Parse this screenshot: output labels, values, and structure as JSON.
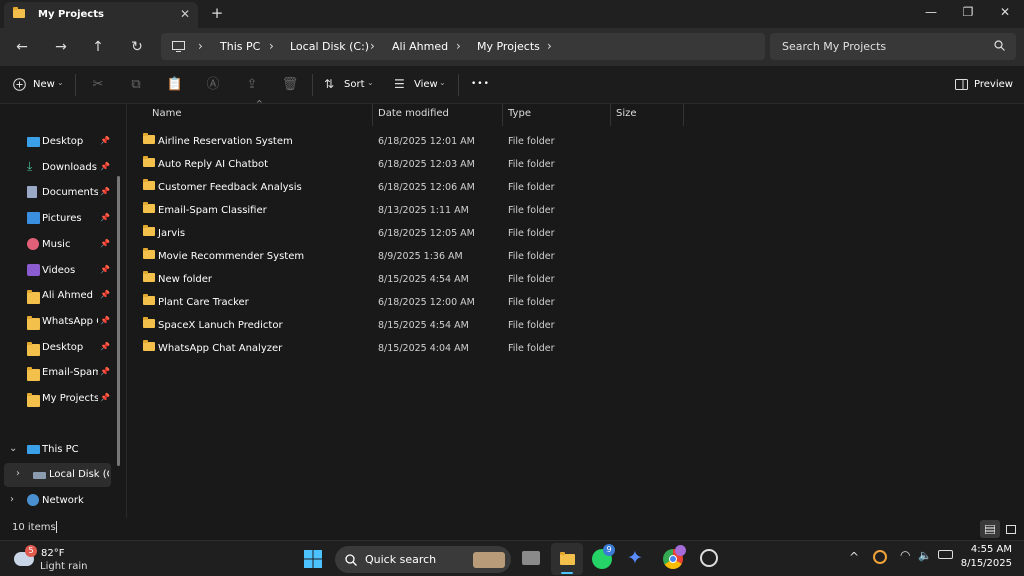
{
  "window": {
    "tab_title": "My Projects",
    "tab_close": "✕",
    "new_tab": "+",
    "minimize": "—",
    "restore": "❐",
    "close": "✕"
  },
  "nav": {
    "back": "←",
    "forward": "→",
    "up": "↑",
    "refresh": "↻",
    "breadcrumb": [
      "This PC",
      "Local Disk (C:)",
      "Ali Ahmed",
      "My Projects"
    ],
    "search_placeholder": "Search My Projects"
  },
  "toolbar": {
    "new_label": "New",
    "sort_label": "Sort",
    "view_label": "View",
    "more_label": "•••",
    "preview_label": "Preview"
  },
  "sidebar": {
    "quick_access": [
      {
        "label": "Desktop",
        "icon": "desktop-icon"
      },
      {
        "label": "Downloads",
        "icon": "download-icon"
      },
      {
        "label": "Documents",
        "icon": "documents-icon"
      },
      {
        "label": "Pictures",
        "icon": "pictures-icon"
      },
      {
        "label": "Music",
        "icon": "music-icon"
      },
      {
        "label": "Videos",
        "icon": "videos-icon"
      },
      {
        "label": "Ali Ahmed",
        "icon": "folder-icon"
      },
      {
        "label": "WhatsApp Ch",
        "icon": "folder-icon"
      },
      {
        "label": "Desktop",
        "icon": "folder-icon"
      },
      {
        "label": "Email-Spam C",
        "icon": "folder-icon"
      },
      {
        "label": "My Projects",
        "icon": "folder-icon"
      }
    ],
    "this_pc": "This PC",
    "local_disk": "Local Disk (C:)",
    "network": "Network"
  },
  "columns": {
    "name": "Name",
    "date_modified": "Date modified",
    "type": "Type",
    "size": "Size"
  },
  "files": [
    {
      "name": "Airline Reservation System",
      "date": "6/18/2025 12:01 AM",
      "type": "File folder"
    },
    {
      "name": "Auto Reply AI Chatbot",
      "date": "6/18/2025 12:03 AM",
      "type": "File folder"
    },
    {
      "name": "Customer Feedback Analysis",
      "date": "6/18/2025 12:06 AM",
      "type": "File folder"
    },
    {
      "name": "Email-Spam Classifier",
      "date": "8/13/2025 1:11 AM",
      "type": "File folder"
    },
    {
      "name": "Jarvis",
      "date": "6/18/2025 12:05 AM",
      "type": "File folder"
    },
    {
      "name": "Movie Recommender System",
      "date": "8/9/2025 1:36 AM",
      "type": "File folder"
    },
    {
      "name": "New folder",
      "date": "8/15/2025 4:54 AM",
      "type": "File folder"
    },
    {
      "name": "Plant Care Tracker",
      "date": "6/18/2025 12:00 AM",
      "type": "File folder"
    },
    {
      "name": "SpaceX Lanuch Predictor",
      "date": "8/15/2025 4:54 AM",
      "type": "File folder"
    },
    {
      "name": "WhatsApp Chat Analyzer",
      "date": "8/15/2025 4:04 AM",
      "type": "File folder"
    }
  ],
  "status": {
    "item_count": "10 items"
  },
  "taskbar": {
    "weather_badge": "5",
    "temperature": "82°F",
    "condition": "Light rain",
    "search_label": "Quick search",
    "whatsapp_badge": "9",
    "time": "4:55 AM",
    "date": "8/15/2025"
  },
  "colors": {
    "folder": "#f3c14b",
    "accent": "#4cc2ff"
  }
}
